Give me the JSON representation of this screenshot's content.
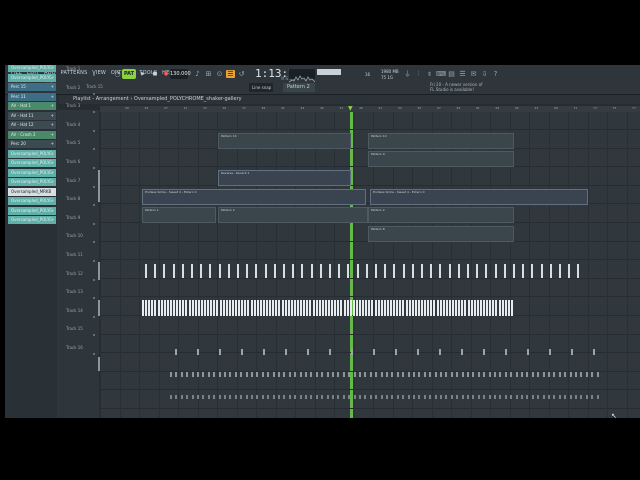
{
  "menu": [
    "FILE",
    "EDIT",
    "ADD",
    "PATTERNS",
    "VIEW",
    "OPTIONS",
    "TOOLS",
    "HELP"
  ],
  "hints": [
    "colour house small.flp",
    "54:09:09"
  ],
  "transport": {
    "pattern_label": "PAT",
    "tempo": "130.000",
    "time": "1:13:74",
    "time_sub": "M:S:CS"
  },
  "monitor": {
    "cpu": "16",
    "memory": "1980 MB",
    "memory2": "75 1G"
  },
  "news": [
    "Fri 20 - A newer version of",
    "FL Studio is available!"
  ],
  "selectors": {
    "pattern": "Pattern 2",
    "snap": "Line snap",
    "track": "Track 15"
  },
  "playlist": {
    "title": "Playlist - Arrangement › Oversampled_POLYCHROME_shaker-gallery"
  },
  "channels": [
    {
      "label": "Oversampled_POLYC",
      "color": "#5fb0a8"
    },
    {
      "label": "Oversampled_POLYC",
      "color": "#5fb0a8"
    },
    {
      "label": "Oversampled_POLYC",
      "color": "#5fb0a8"
    },
    {
      "label": "Perc 15",
      "color": "#3d6e86"
    },
    {
      "label": "Perc 11",
      "color": "#3d6e86"
    },
    {
      "label": "AV - Hat 1",
      "color": "#4a8a6b"
    },
    {
      "label": "AV - Hat 11",
      "color": "#3c4a52"
    },
    {
      "label": "AV - Hat 12",
      "color": "#3c4a52"
    },
    {
      "label": "AV - Crash 2",
      "color": "#4a8a6b"
    },
    {
      "label": "Perc 20",
      "color": "#3c4a52"
    },
    {
      "label": "Oversampled_POLYC",
      "color": "#5fb0a8"
    },
    {
      "label": "Oversampled_POLYC",
      "color": "#5fb0a8"
    },
    {
      "label": "Oversampled_POLYC",
      "color": "#5fb0a8"
    },
    {
      "label": "Oversampled_POLYC",
      "color": "#5fb0a8"
    },
    {
      "label": "Oversampled_MRKB",
      "color": "#d8dfe3"
    },
    {
      "label": "Oversampled_POLYC",
      "color": "#5fb0a8"
    },
    {
      "label": "Oversampled_POLYC",
      "color": "#5fb0a8"
    },
    {
      "label": "Oversampled_POLYC",
      "color": "#5fb0a8"
    }
  ],
  "tracks": [
    "Track 1",
    "Track 2",
    "Track 3",
    "Track 4",
    "Track 5",
    "Track 6",
    "Track 7",
    "Track 8",
    "Track 9",
    "Track 10",
    "Track 11",
    "Track 12",
    "Track 13",
    "Track 14",
    "Track 15",
    "Track 16"
  ],
  "ruler": [
    "29",
    "25",
    "27",
    "31",
    "33",
    "35",
    "37",
    "39",
    "41",
    "43",
    "45",
    "47",
    "49",
    "51",
    "53",
    "55",
    "57",
    "59",
    "61",
    "63",
    "65",
    "67",
    "69",
    "71",
    "73",
    "75",
    "77",
    "79"
  ],
  "clips": {
    "pattern_a": "Pattern 10",
    "pattern_b": "Pattern 9",
    "pattern_c": "Pattern 8",
    "pattern_d": "Pattern 3",
    "pattern_e": "Pattern 1",
    "pattern_f": "Pattern 2",
    "automation1": "Reverse - Reverb 1",
    "automation2": "Endless Smile - Sweet 4 - Extern 0",
    "automation3": "Endless Smile - Sweet 4 - Extern 0"
  }
}
